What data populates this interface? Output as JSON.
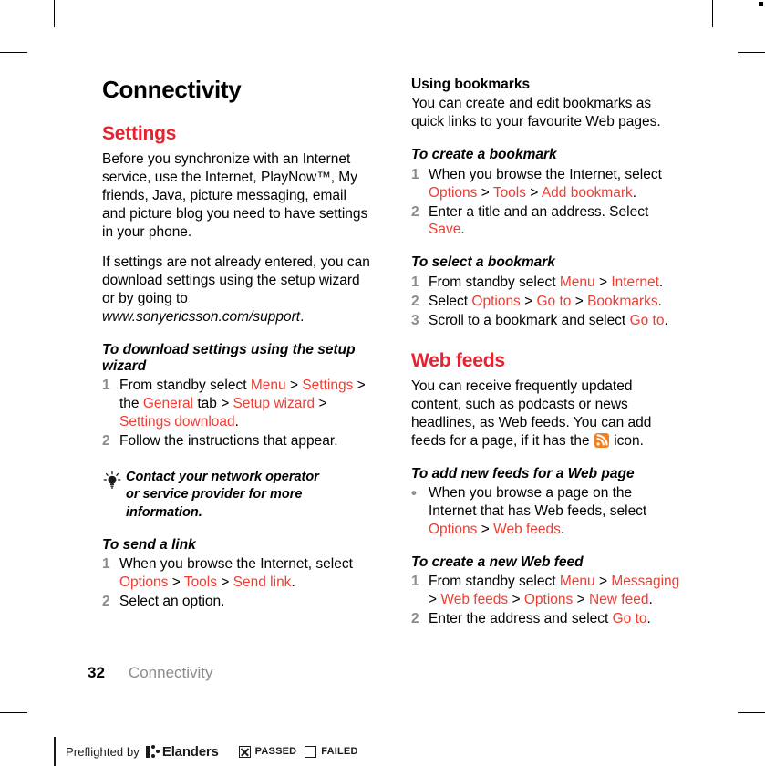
{
  "colors": {
    "heading_red": "#E8212E",
    "link_red": "#F03C32",
    "marker_gray": "#8C8C8C",
    "rss_orange": "#F08020"
  },
  "page": {
    "chapter_title": "Connectivity",
    "folio": "32",
    "running_head": "Connectivity"
  },
  "left_column": {
    "section_title": "Settings",
    "intro_paragraph": "Before you synchronize with an Internet service, use the Internet, PlayNow™, My friends, Java, picture messaging, email and picture blog you need to have settings in your phone.",
    "second_paragraph_prefix": "If settings are not already entered, you can download settings using the setup wizard or by going to ",
    "second_paragraph_url": "www.sonyericsson.com/support",
    "second_paragraph_suffix": ".",
    "proc_setup_wizard": {
      "heading": "To download settings using the setup wizard",
      "step1": {
        "marker": "1",
        "t1": "From standby select ",
        "l1": "Menu",
        "s1": " > ",
        "l2": "Settings",
        "s2": " > ",
        "t2": "the ",
        "l3": "General",
        "t3": " tab ",
        "s3": "> ",
        "l4": "Setup wizard",
        "s4": " > ",
        "l5": "Settings download",
        "t4": "."
      },
      "step2": {
        "marker": "2",
        "t1": "Follow the instructions that appear."
      }
    },
    "tip": {
      "icon": "lightbulb-icon",
      "line1": "Contact your network operator",
      "line2": "or service provider for more information."
    },
    "proc_send_link": {
      "heading": "To send a link",
      "step1": {
        "marker": "1",
        "t1": "When you browse the Internet, select ",
        "l1": "Options",
        "s1": " > ",
        "l2": "Tools",
        "s2": " > ",
        "l3": "Send link",
        "t2": "."
      },
      "step2": {
        "marker": "2",
        "t1": "Select an option."
      }
    }
  },
  "right_column": {
    "using_bookmarks": {
      "heading": "Using bookmarks",
      "paragraph": "You can create and edit bookmarks as quick links to your favourite Web pages."
    },
    "proc_create_bookmark": {
      "heading": "To create a bookmark",
      "step1": {
        "marker": "1",
        "t1": "When you browse the Internet, select ",
        "l1": "Options",
        "s1": " > ",
        "l2": "Tools",
        "s2": " > ",
        "l3": "Add bookmark",
        "t2": "."
      },
      "step2": {
        "marker": "2",
        "t1": "Enter a title and an address. Select ",
        "l1": "Save",
        "t2": "."
      }
    },
    "proc_select_bookmark": {
      "heading": "To select a bookmark",
      "step1": {
        "marker": "1",
        "t1": "From standby select ",
        "l1": "Menu",
        "s1": " > ",
        "l2": "Internet",
        "t2": "."
      },
      "step2": {
        "marker": "2",
        "t1": "Select ",
        "l1": "Options",
        "s1": " > ",
        "l2": "Go to",
        "s2": " > ",
        "l3": "Bookmarks",
        "t2": "."
      },
      "step3": {
        "marker": "3",
        "t1": "Scroll to a bookmark and select ",
        "l1": "Go to",
        "t2": "."
      }
    },
    "web_feeds": {
      "section_title": "Web feeds",
      "paragraph_prefix": "You can receive frequently updated content, such as podcasts or news headlines, as Web feeds. You can add feeds for a page, if it has the ",
      "icon": "rss-feed-icon",
      "paragraph_suffix": " icon."
    },
    "proc_add_feeds": {
      "heading": "To add new feeds for a Web page",
      "bullet": {
        "marker": "•",
        "t1": "When you browse a page on the Internet that has Web feeds, select ",
        "l1": "Options",
        "s1": " > ",
        "l2": "Web feeds",
        "t2": "."
      }
    },
    "proc_create_feed": {
      "heading": "To create a new Web feed",
      "step1": {
        "marker": "1",
        "t1": "From standby select ",
        "l1": "Menu",
        "s1": " > ",
        "l2": "Messaging",
        "s2": " > ",
        "l3": "Web feeds",
        "s3": " > ",
        "l4": "Options",
        "s4": " > ",
        "l5": "New feed",
        "t2": "."
      },
      "step2": {
        "marker": "2",
        "t1": "Enter the address and select ",
        "l1": "Go to",
        "t2": "."
      }
    }
  },
  "preflight": {
    "label": "Preflighted by",
    "wordmark": "Elanders",
    "passed_label": "PASSED",
    "failed_label": "FAILED"
  }
}
